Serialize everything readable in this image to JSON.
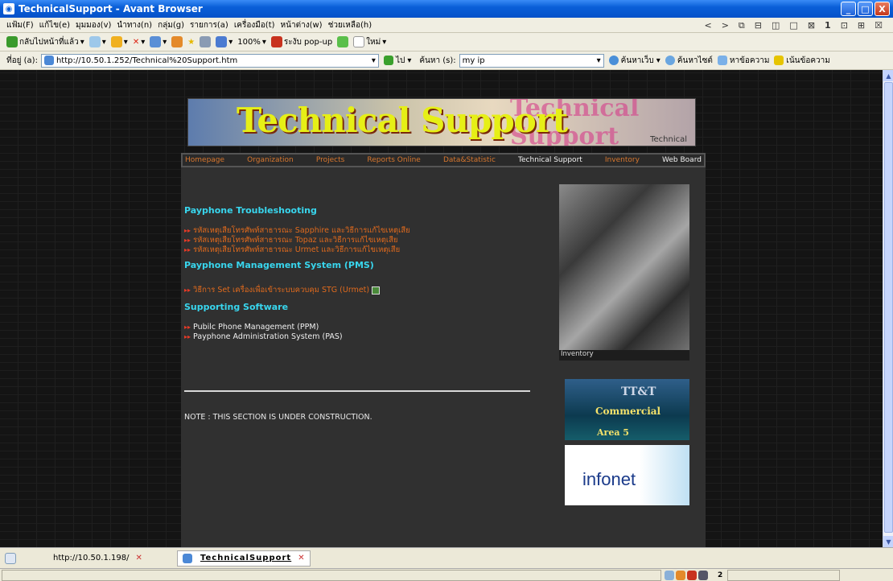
{
  "window": {
    "title": "TechnicalSupport - Avant Browser",
    "min": "_",
    "max": "□",
    "close": "X"
  },
  "menu": [
    "แฟ้ม(F)",
    "แก้ไข(e)",
    "มุมมอง(v)",
    "นำทาง(n)",
    "กลุ่ม(g)",
    "รายการ(a)",
    "เครื่องมือ(t)",
    "หน้าต่าง(w)",
    "ช่วยเหลือ(h)"
  ],
  "menu_icons": [
    "<",
    ">",
    "⧉",
    "⊟",
    "◫",
    "□",
    "⊠",
    "1",
    "⊡",
    "⊞",
    "☒"
  ],
  "toolbar": {
    "back": "กลับไปหน้าที่แล้ว",
    "zoom": "100%",
    "popup": "ระงับ pop-up",
    "new": "ใหม่"
  },
  "address": {
    "label": "ที่อยู่ (a):",
    "url": "http://10.50.1.252/Technical%20Support.htm",
    "go": "ไป",
    "search_label": "ค้นหา (s):",
    "search_value": "my ip",
    "search_web": "ค้นหาเว็บ",
    "search_site": "ค้นหาไซต์",
    "find": "หาข้อความ",
    "highlight": "เน้นข้อความ"
  },
  "page": {
    "banner_title": "Technical Support",
    "banner_ghost": "Technical Support",
    "banner_sub": "Technical",
    "nav": [
      "Homepage",
      "Organization",
      "Projects",
      "Reports Online",
      "Data&Statistic",
      "Technical Support",
      "Inventory",
      "Web Board"
    ],
    "h_payphone": "Payphone Troubleshooting",
    "payphone_links": [
      "รหัสเหตุเสียโทรศัพท์สาธารณะ Sapphire และวิธีการแก้ไขเหตุเสีย",
      "รหัสเหตุเสียโทรศัพท์สาธารณะ Topaz และวิธีการแก้ไขเหตุเสีย",
      "รหัสเหตุเสียโทรศัพท์สาธารณะ Urmet และวิธีการแก้ไขเหตุเสีย"
    ],
    "h_pms": "Payphone Management System (PMS)",
    "pms_link": "วิธีการ Set เครื่องเพื่อเข้าระบบควบคุม STG (Urmet)",
    "h_software": "Supporting Software",
    "software_links": [
      "Pubilc Phone Management (PPM)",
      "Payphone Administration System (PAS)"
    ],
    "note": "NOTE : THIS SECTION IS UNDER CONSTRUCTION.",
    "inventory": "Inventory",
    "tt_logo": "TT&T",
    "tt_commercial": "Commercial",
    "tt_area": "Area 5",
    "infonet": "infonet"
  },
  "tabs": [
    {
      "label": "http://10.50.1.198/"
    },
    {
      "label": "TechnicalSupport"
    }
  ],
  "status": {
    "num": "2"
  }
}
